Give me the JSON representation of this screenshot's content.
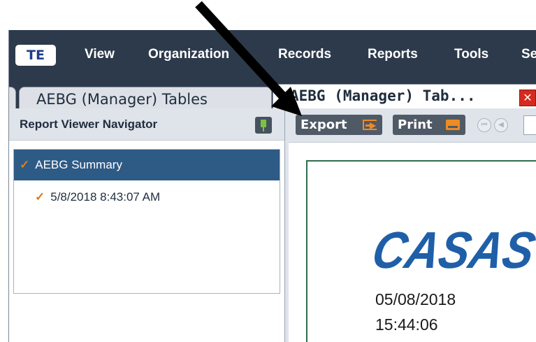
{
  "menubar": {
    "logo": "TE",
    "items": [
      "View",
      "Organization",
      "Records",
      "Reports",
      "Tools",
      "Se"
    ]
  },
  "tabs": [
    {
      "label": "AEBG (Manager) Tables"
    },
    {
      "label": "AEBG (Manager) Tab..."
    }
  ],
  "tab_close_icon": "close-icon",
  "navigator": {
    "title": "Report Viewer Navigator",
    "pin_icon": "pin-icon",
    "tree": [
      {
        "label": "AEBG Summary",
        "checked": true,
        "selected": true
      },
      {
        "label": "5/8/2018 8:43:07 AM",
        "checked": true,
        "selected": false
      }
    ]
  },
  "viewer": {
    "toolbar": {
      "export_label": "Export",
      "print_label": "Print",
      "export_icon": "export-icon",
      "print_icon": "printer-icon",
      "first_page_icon": "first-page-icon",
      "prev_page_icon": "previous-page-icon"
    },
    "report": {
      "logo_text": "CASAS",
      "date": "05/08/2018",
      "time": "15:44:06"
    }
  },
  "colors": {
    "menubar": "#2d3a4b",
    "selected_row": "#2e5a86",
    "accent_orange": "#f08a24",
    "casas_blue": "#1f5fa8",
    "close_red": "#d52a1f"
  }
}
